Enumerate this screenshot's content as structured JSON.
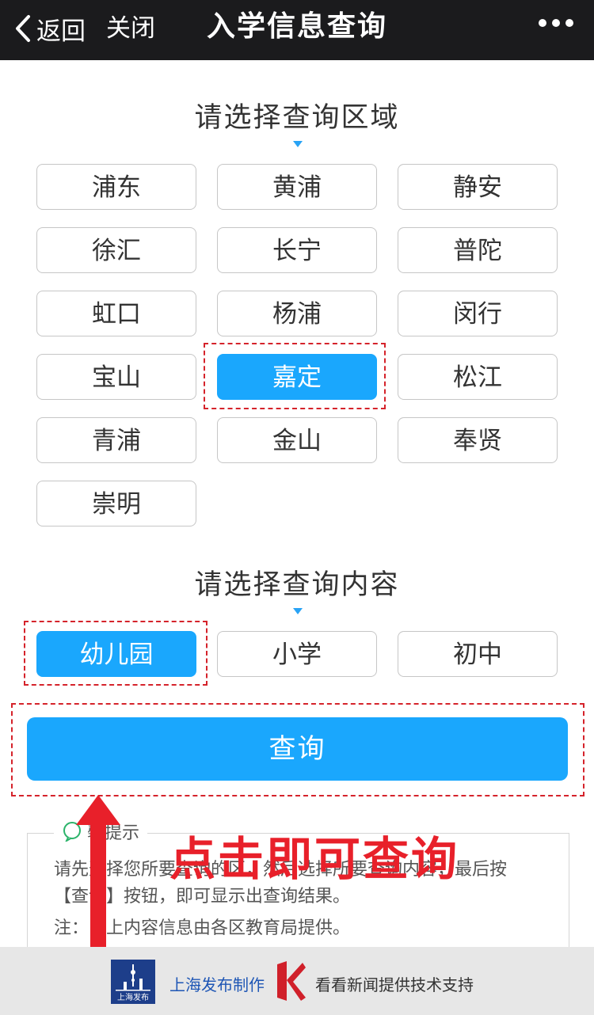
{
  "header": {
    "back_label": "返回",
    "close_label": "关闭",
    "title": "入学信息查询",
    "more_icon": "more-dots-icon"
  },
  "region_section": {
    "heading": "请选择查询区域",
    "options": [
      "浦东",
      "黄浦",
      "静安",
      "徐汇",
      "长宁",
      "普陀",
      "虹口",
      "杨浦",
      "闵行",
      "宝山",
      "嘉定",
      "松江",
      "青浦",
      "金山",
      "奉贤",
      "崇明"
    ],
    "selected": "嘉定"
  },
  "content_section": {
    "heading": "请选择查询内容",
    "options": [
      "幼儿园",
      "小学",
      "初中"
    ],
    "selected": "幼儿园"
  },
  "query_button": {
    "label": "查询"
  },
  "tips": {
    "title": "馨提示",
    "line1": "请先选择您所要查询的区，然后选择所要查询内容，最后按",
    "line2": "【查询】按钮，即可显示出查询结果。",
    "note": "注：以上内容信息由各区教育局提供。"
  },
  "annotation": {
    "text": "点击即可查询"
  },
  "footer": {
    "left_logo_text": "上海发布",
    "left_text": "上海发布制作",
    "right_text": "看看新闻提供技术支持"
  },
  "colors": {
    "accent": "#1aa7fd",
    "annotation_red": "#e8202a",
    "header_bg": "#1b1b1d"
  }
}
